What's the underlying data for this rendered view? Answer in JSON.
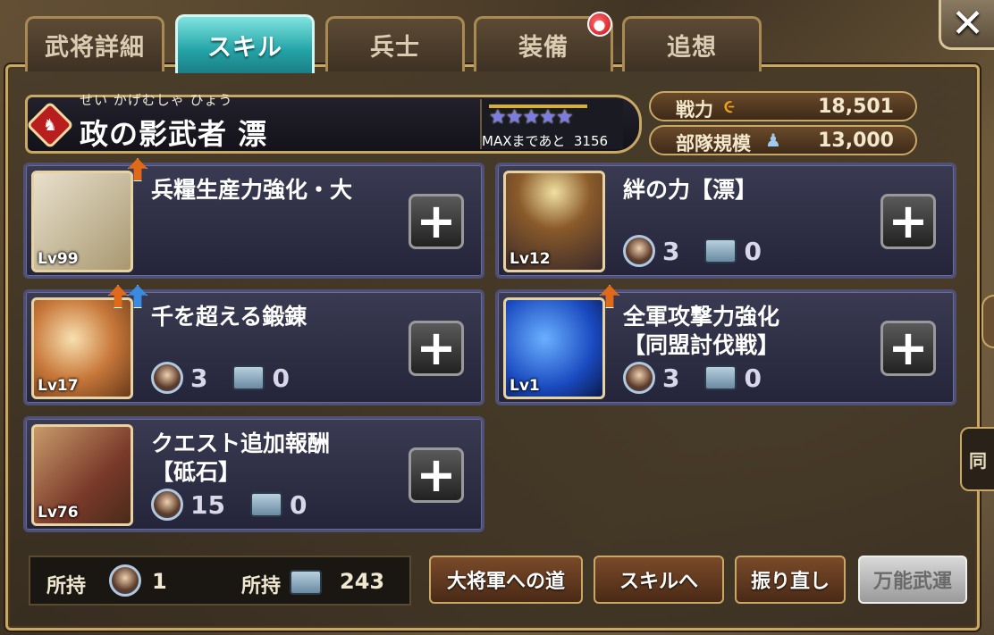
{
  "tabs": [
    {
      "label": "武将詳細",
      "active": false
    },
    {
      "label": "スキル",
      "active": true
    },
    {
      "label": "兵士",
      "active": false
    },
    {
      "label": "装備",
      "active": false,
      "badge": true
    },
    {
      "label": "追想",
      "active": false
    }
  ],
  "close_label": "✕",
  "general": {
    "ruby": "せい かげむしゃ ひょう",
    "name": "政の影武者 漂",
    "stars": "★★★★★",
    "max_text": "MAXまであと",
    "max_value": "3156"
  },
  "stats": {
    "power_label": "戦力",
    "power_value": "18,501",
    "troop_label": "部隊規模",
    "troop_value": "13,000"
  },
  "skills": [
    {
      "name": "兵糧生産力強化・大",
      "level": "Lv99",
      "medal": "",
      "stone": "",
      "icon_color": "#cfc7b4",
      "arrows": [
        "orange"
      ]
    },
    {
      "name": "絆の力【漂】",
      "level": "Lv12",
      "medal": "3",
      "stone": "0",
      "icon_color": "#7a5a2a",
      "arrows": []
    },
    {
      "name": "千を超える鍛錬",
      "level": "Lv17",
      "medal": "3",
      "stone": "0",
      "icon_color": "#d89a50",
      "arrows": [
        "orange",
        "blue"
      ]
    },
    {
      "name": "全軍攻撃力強化\n【同盟討伐戦】",
      "name_line1": "全軍攻撃力強化",
      "name_line2": "【同盟討伐戦】",
      "level": "Lv1",
      "medal": "3",
      "stone": "0",
      "icon_color": "#2a6ae0",
      "arrows": [
        "orange"
      ]
    },
    {
      "name_line1": "クエスト追加報酬",
      "name_line2": "【砥石】",
      "level": "Lv76",
      "medal": "15",
      "stone": "0",
      "icon_color": "#8a5a3a",
      "arrows": []
    }
  ],
  "owned": {
    "label1": "所持",
    "value1": "1",
    "label2": "所持",
    "value2": "243"
  },
  "buttons": {
    "road": "大将軍への道",
    "to_skill": "スキルへ",
    "reroll": "振り直し",
    "universal": "万能武運"
  },
  "side_tag": "同"
}
